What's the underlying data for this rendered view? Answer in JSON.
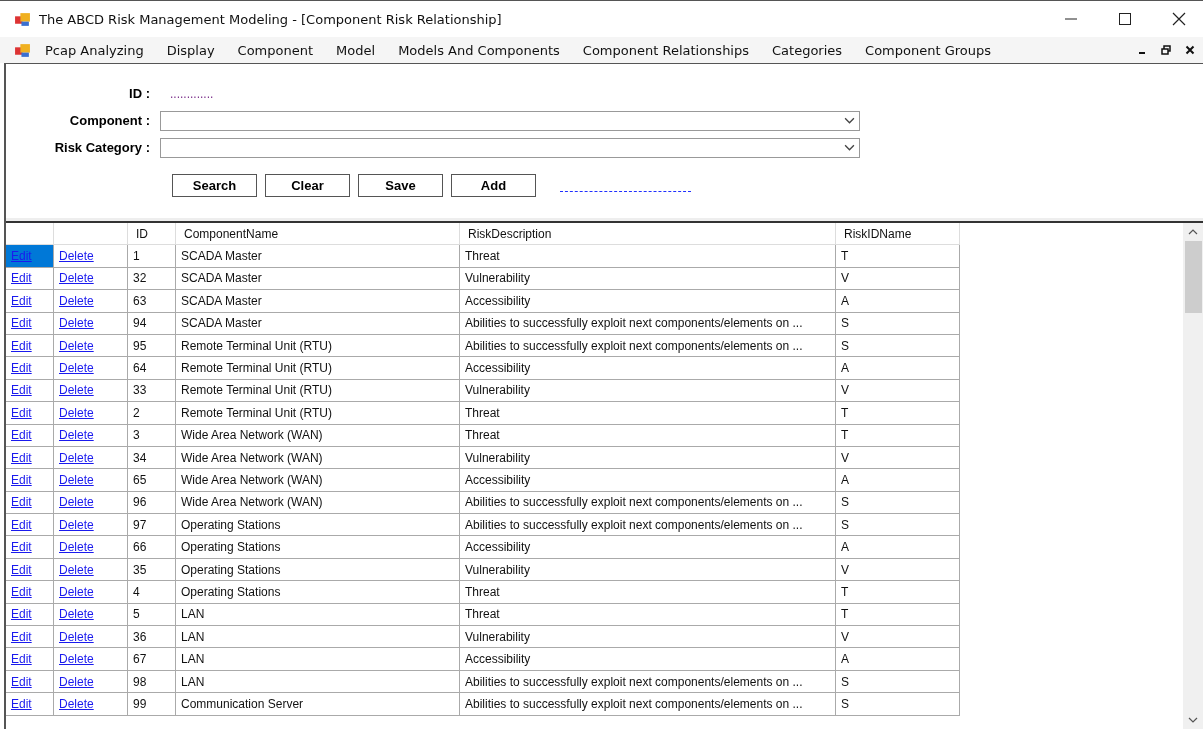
{
  "window": {
    "title": "The ABCD Risk Management Modeling - [Component Risk Relationship]"
  },
  "menu": [
    "Pcap Analyzing",
    "Display",
    "Component",
    "Model",
    "Models And Components",
    "Component Relationships",
    "Categories",
    "Component Groups"
  ],
  "form": {
    "id_label": "ID :",
    "id_value": ".............",
    "component_label": "Component :",
    "risk_category_label": "Risk Category :"
  },
  "buttons": [
    "Search",
    "Clear",
    "Save",
    "Add"
  ],
  "table": {
    "columns": [
      "ID",
      "ComponentName",
      "RiskDescription",
      "RiskIDName"
    ],
    "rows": [
      {
        "edit": "Edit",
        "delete": "Delete",
        "id": "1",
        "component": "SCADA Master",
        "risk": "Threat",
        "risk_id": "T",
        "selected": true
      },
      {
        "edit": "Edit",
        "delete": "Delete",
        "id": "32",
        "component": "SCADA Master",
        "risk": "Vulnerability",
        "risk_id": "V",
        "selected": false
      },
      {
        "edit": "Edit",
        "delete": "Delete",
        "id": "63",
        "component": "SCADA Master",
        "risk": "Accessibility",
        "risk_id": "A",
        "selected": false
      },
      {
        "edit": "Edit",
        "delete": "Delete",
        "id": "94",
        "component": "SCADA Master",
        "risk": "Abilities to successfully exploit next components/elements on ...",
        "risk_id": "S",
        "selected": false
      },
      {
        "edit": "Edit",
        "delete": "Delete",
        "id": "95",
        "component": "Remote Terminal Unit (RTU)",
        "risk": "Abilities to successfully exploit next components/elements on ...",
        "risk_id": "S",
        "selected": false
      },
      {
        "edit": "Edit",
        "delete": "Delete",
        "id": "64",
        "component": "Remote Terminal Unit (RTU)",
        "risk": "Accessibility",
        "risk_id": "A",
        "selected": false
      },
      {
        "edit": "Edit",
        "delete": "Delete",
        "id": "33",
        "component": "Remote Terminal Unit (RTU)",
        "risk": "Vulnerability",
        "risk_id": "V",
        "selected": false
      },
      {
        "edit": "Edit",
        "delete": "Delete",
        "id": "2",
        "component": "Remote Terminal Unit (RTU)",
        "risk": "Threat",
        "risk_id": "T",
        "selected": false
      },
      {
        "edit": "Edit",
        "delete": "Delete",
        "id": "3",
        "component": "Wide Area Network (WAN)",
        "risk": "Threat",
        "risk_id": "T",
        "selected": false
      },
      {
        "edit": "Edit",
        "delete": "Delete",
        "id": "34",
        "component": "Wide Area Network (WAN)",
        "risk": "Vulnerability",
        "risk_id": "V",
        "selected": false
      },
      {
        "edit": "Edit",
        "delete": "Delete",
        "id": "65",
        "component": "Wide Area Network (WAN)",
        "risk": "Accessibility",
        "risk_id": "A",
        "selected": false
      },
      {
        "edit": "Edit",
        "delete": "Delete",
        "id": "96",
        "component": "Wide Area Network (WAN)",
        "risk": "Abilities to successfully exploit next components/elements on ...",
        "risk_id": "S",
        "selected": false
      },
      {
        "edit": "Edit",
        "delete": "Delete",
        "id": "97",
        "component": "Operating Stations",
        "risk": "Abilities to successfully exploit next components/elements on ...",
        "risk_id": "S",
        "selected": false
      },
      {
        "edit": "Edit",
        "delete": "Delete",
        "id": "66",
        "component": "Operating Stations",
        "risk": "Accessibility",
        "risk_id": "A",
        "selected": false
      },
      {
        "edit": "Edit",
        "delete": "Delete",
        "id": "35",
        "component": "Operating Stations",
        "risk": "Vulnerability",
        "risk_id": "V",
        "selected": false
      },
      {
        "edit": "Edit",
        "delete": "Delete",
        "id": "4",
        "component": "Operating Stations",
        "risk": "Threat",
        "risk_id": "T",
        "selected": false
      },
      {
        "edit": "Edit",
        "delete": "Delete",
        "id": "5",
        "component": "LAN",
        "risk": "Threat",
        "risk_id": "T",
        "selected": false
      },
      {
        "edit": "Edit",
        "delete": "Delete",
        "id": "36",
        "component": "LAN",
        "risk": "Vulnerability",
        "risk_id": "V",
        "selected": false
      },
      {
        "edit": "Edit",
        "delete": "Delete",
        "id": "67",
        "component": "LAN",
        "risk": "Accessibility",
        "risk_id": "A",
        "selected": false
      },
      {
        "edit": "Edit",
        "delete": "Delete",
        "id": "98",
        "component": "LAN",
        "risk": "Abilities to successfully exploit next components/elements on ...",
        "risk_id": "S",
        "selected": false
      },
      {
        "edit": "Edit",
        "delete": "Delete",
        "id": "99",
        "component": "Communication Server",
        "risk": "Abilities to successfully exploit next components/elements on ...",
        "risk_id": "S",
        "selected": false
      }
    ]
  }
}
